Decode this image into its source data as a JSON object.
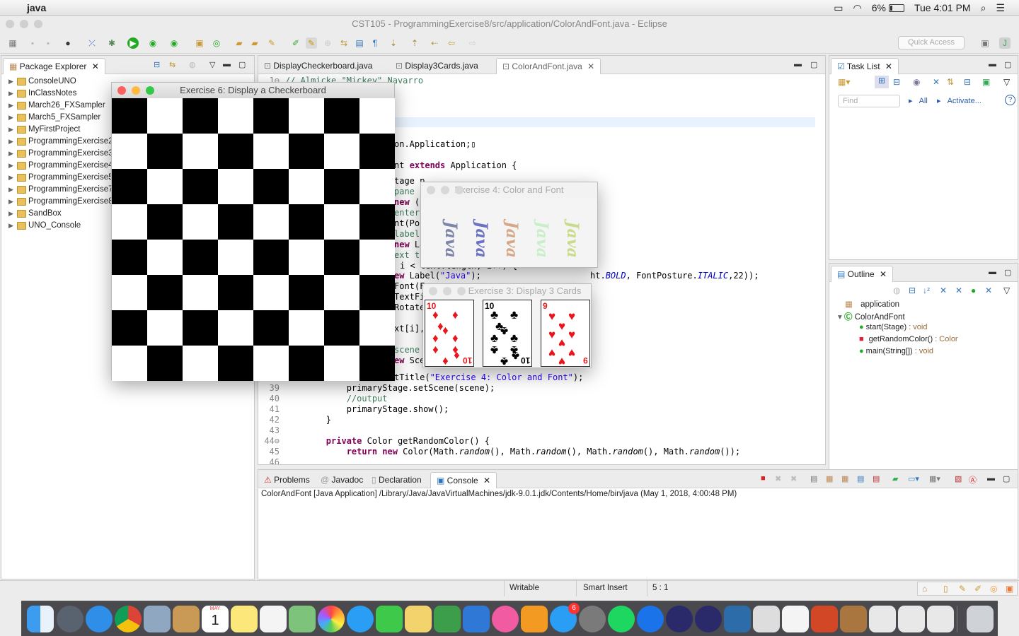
{
  "menubar": {
    "app_name": "java",
    "battery": "6%",
    "clock": "Tue 4:01 PM"
  },
  "window": {
    "title": "CST105 - ProgrammingExercise8/src/application/ColorAndFont.java - Eclipse"
  },
  "toolbar": {
    "quick_access_placeholder": "Quick Access"
  },
  "package_explorer": {
    "tab_label": "Package Explorer",
    "projects": [
      "ConsoleUNO",
      "InClassNotes",
      "March26_FXSampler",
      "March5_FXSampler",
      "MyFirstProject",
      "ProgrammingExercise2",
      "ProgrammingExercise3",
      "ProgrammingExercise4",
      "ProgrammingExercise5",
      "ProgrammingExercise7",
      "ProgrammingExercise8",
      "SandBox",
      "UNO_Console"
    ]
  },
  "editor": {
    "tabs": [
      "DisplayCheckerboard.java",
      "Display3Cards.java",
      "ColorAndFont.java"
    ],
    "active_tab": "ColorAndFont.java"
  },
  "task_list": {
    "tab_label": "Task List",
    "find_placeholder": "Find",
    "all_label": "All",
    "activate_label": "Activate..."
  },
  "outline": {
    "tab_label": "Outline",
    "package": "application",
    "class": "ColorAndFont",
    "members": [
      {
        "name": "start(Stage)",
        "type": " : void"
      },
      {
        "name": "getRandomColor()",
        "type": " : Color"
      },
      {
        "name": "main(String[])",
        "type": " : void"
      }
    ]
  },
  "console": {
    "tabs": [
      "Problems",
      "Javadoc",
      "Declaration",
      "Console"
    ],
    "active_tab": "Console",
    "header": "ColorAndFont [Java Application] /Library/Java/JavaVirtualMachines/jdk-9.0.1.jdk/Contents/Home/bin/java (May 1, 2018, 4:00:48 PM)"
  },
  "statusbar": {
    "writable": "Writable",
    "insert_mode": "Smart Insert",
    "position": "5 : 1"
  },
  "checkerboard_window": {
    "title": "Exercise 6: Display a Checkerboard"
  },
  "color_font_window": {
    "title": "Exercise 4: Color and Font",
    "word": "Java",
    "word_colors": [
      "#7d86a8",
      "#6b71c4",
      "#d6a88a",
      "#c8efc8",
      "#c9dc8a"
    ]
  },
  "cards_window": {
    "title": "Exercise 3: Display 3 Cards",
    "cards": [
      {
        "rank": "10",
        "suit": "♦",
        "color": "#e8161c"
      },
      {
        "rank": "10",
        "suit": "♣",
        "color": "#000000"
      },
      {
        "rank": "9",
        "suit": "♥",
        "color": "#e8161c"
      }
    ]
  },
  "dock": {
    "calendar_month": "MAY",
    "calendar_day": "1",
    "badge": "6"
  }
}
